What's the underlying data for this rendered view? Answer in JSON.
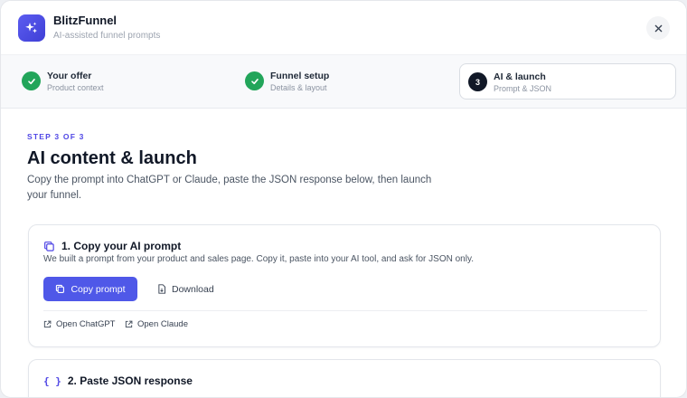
{
  "app": {
    "title": "BlitzFunnel",
    "subtitle": "AI-assisted funnel prompts",
    "logo_icon": "sparkles-icon"
  },
  "stepper": {
    "steps": [
      {
        "number": "1",
        "title": "Your offer",
        "subtitle": "Product context",
        "status": "done"
      },
      {
        "number": "2",
        "title": "Funnel setup",
        "subtitle": "Details & layout",
        "status": "done"
      },
      {
        "number": "3",
        "title": "AI & launch",
        "subtitle": "Prompt & JSON",
        "status": "active"
      }
    ]
  },
  "content": {
    "step_label": "STEP 3 OF 3",
    "title": "AI content & launch",
    "description": "Copy the prompt into ChatGPT or Claude, paste the JSON response below, then launch your funnel."
  },
  "card1": {
    "title": "1. Copy your AI prompt",
    "description": "We built a prompt from your product and sales page. Copy it, paste into your AI tool, and ask for JSON only.",
    "copy_button": "Copy prompt",
    "download_button": "Download",
    "links": [
      "Open ChatGPT",
      "Open Claude"
    ]
  },
  "card2": {
    "icon": "{ }",
    "title": "2. Paste JSON response"
  },
  "colors": {
    "accent": "#4f58e8",
    "success": "#22a55a",
    "active_step": "#111827"
  }
}
